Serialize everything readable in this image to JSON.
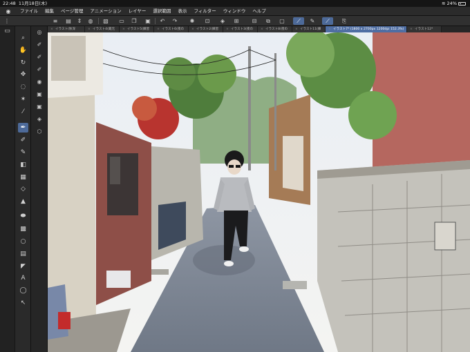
{
  "status": {
    "time": "22:48",
    "date": "11月18日(木)",
    "battery": "24%"
  },
  "menu": [
    "ファイル",
    "編集",
    "ページ管理",
    "アニメーション",
    "レイヤー",
    "選択範囲",
    "表示",
    "フィルター",
    "ウィンドウ",
    "ヘルプ"
  ],
  "tabs": [
    {
      "label": "イラスト(秋深",
      "active": false
    },
    {
      "label": "イラスト4(蔵元",
      "active": false
    },
    {
      "label": "イラスト5(練習",
      "active": false
    },
    {
      "label": "イラスト6(夜の",
      "active": false
    },
    {
      "label": "イラスト2(練習",
      "active": false
    },
    {
      "label": "イラスト3(夜の",
      "active": false
    },
    {
      "label": "イラスト8(夜の",
      "active": false
    },
    {
      "label": "イラスト11(練",
      "active": false
    },
    {
      "label": "イラスト7* (1800 x 2700px 1200dpi 152.3%)",
      "active": true
    },
    {
      "label": "イラスト12*",
      "active": false
    }
  ],
  "colors": {
    "accent": "#4d6a99",
    "active_tab": "#4f6ea3",
    "main_color": "#000000",
    "sub_color": "#ffffff"
  },
  "icons": {
    "tools": [
      "zoom-icon",
      "hand-icon",
      "rotate-icon",
      "move-icon",
      "lasso-icon",
      "magic-wand-icon",
      "eyedropper-icon",
      "pen-icon",
      "pencil-icon",
      "brush-icon",
      "fill-icon",
      "gradient-icon",
      "eraser-icon",
      "blend-icon",
      "figure-icon",
      "frame-icon",
      "ruler-icon",
      "text-icon",
      "balloon-icon",
      "correction-icon"
    ],
    "commands": [
      "menu-icon",
      "new-icon",
      "open-icon",
      "save-icon",
      "undo-icon",
      "redo-icon",
      "clear-icon",
      "fill-icon",
      "select-all-icon",
      "deselect-icon",
      "snap-ruler-icon",
      "snap-grid-icon",
      "snap-special-icon"
    ]
  }
}
